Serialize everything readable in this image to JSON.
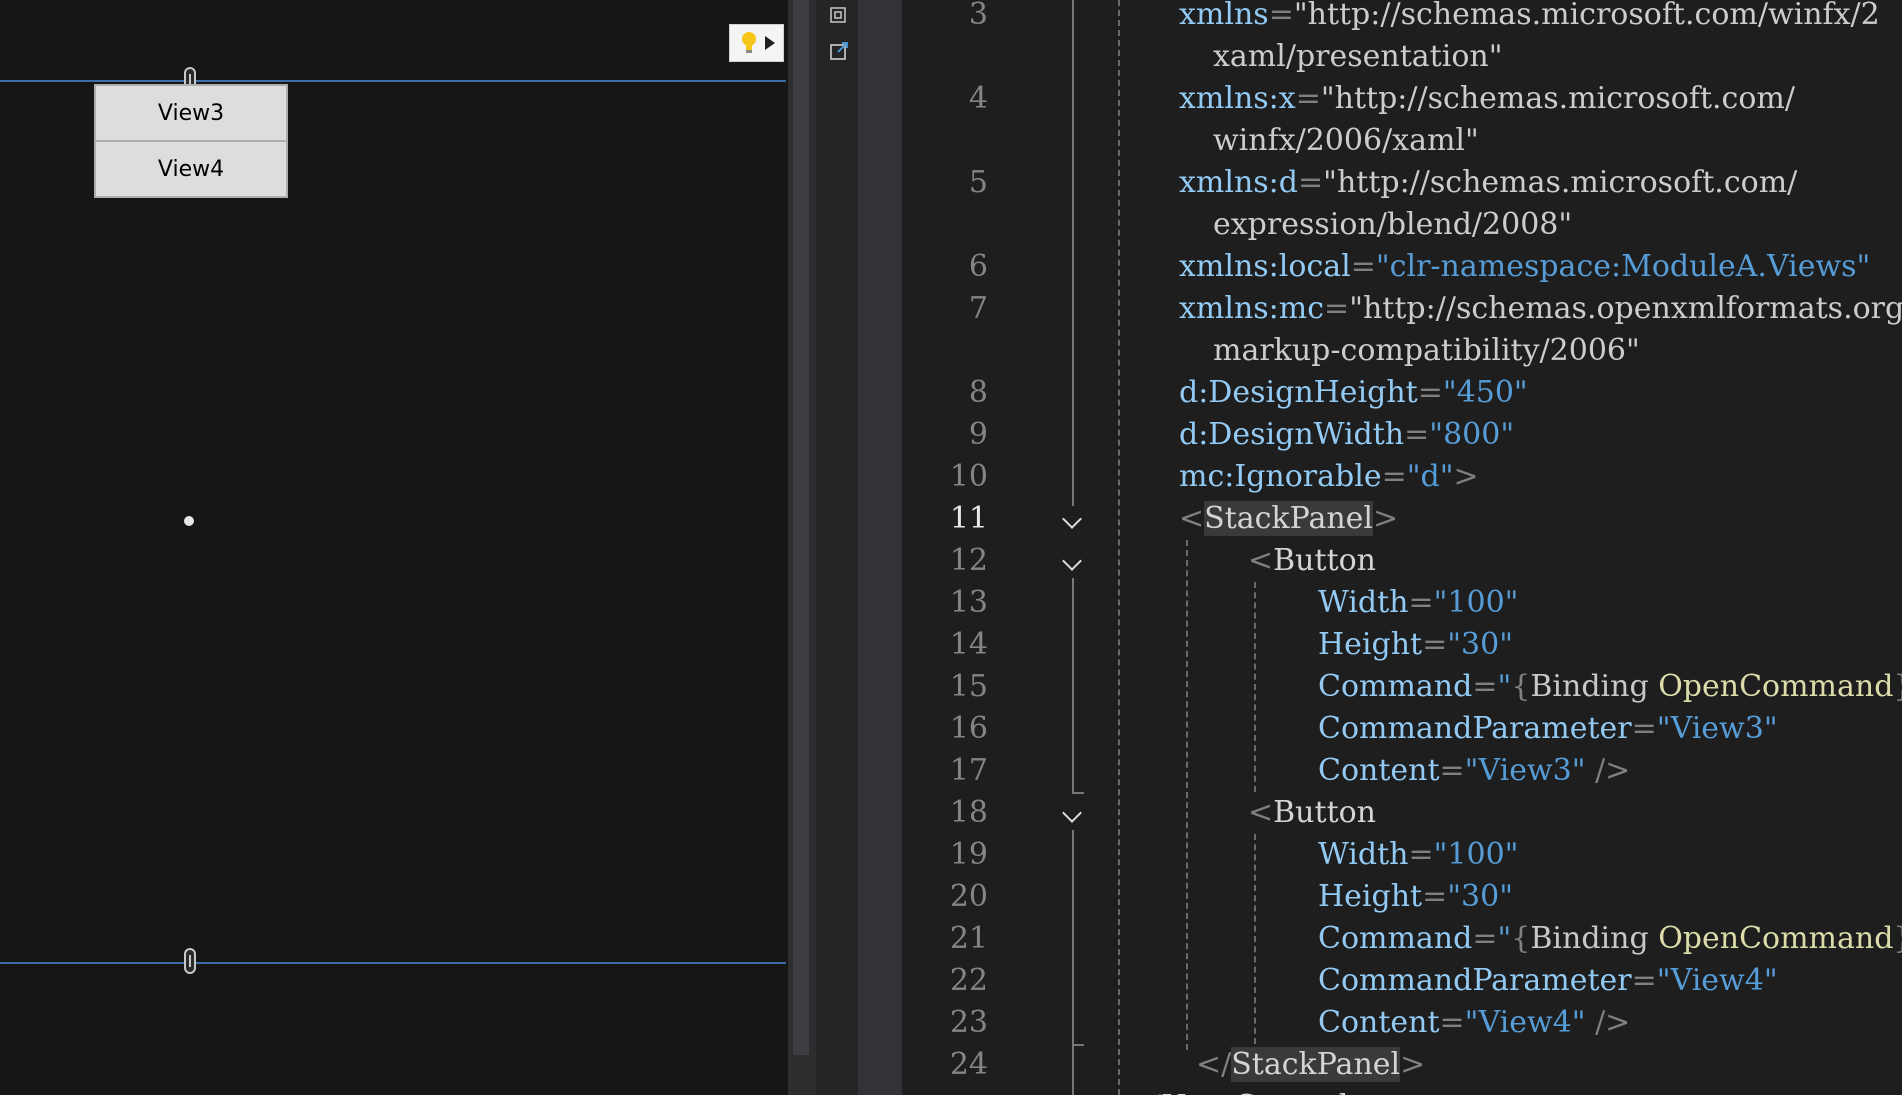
{
  "designer": {
    "buttons": [
      {
        "label": "View3"
      },
      {
        "label": "View4"
      }
    ],
    "lightbulb_icon": "lightbulb-icon"
  },
  "editor": {
    "lines": [
      {
        "n": "3",
        "text": "xmlns=\"http://schemas.microsoft.com/winfx/2"
      },
      {
        "n": "",
        "text": "xaml/presentation\""
      },
      {
        "n": "4",
        "text": "xmlns:x=\"http://schemas.microsoft.com/"
      },
      {
        "n": "",
        "text": "winfx/2006/xaml\""
      },
      {
        "n": "5",
        "text": "xmlns:d=\"http://schemas.microsoft.com/"
      },
      {
        "n": "",
        "text": "expression/blend/2008\""
      },
      {
        "n": "6",
        "text": "xmlns:local=\"clr-namespace:ModuleA.Views\""
      },
      {
        "n": "7",
        "text": "xmlns:mc=\"http://schemas.openxmlformats.org"
      },
      {
        "n": "",
        "text": "markup-compatibility/2006\""
      },
      {
        "n": "8",
        "text": "d:DesignHeight=\"450\""
      },
      {
        "n": "9",
        "text": "d:DesignWidth=\"800\""
      },
      {
        "n": "10",
        "text": "mc:Ignorable=\"d\">"
      },
      {
        "n": "11",
        "text": "<StackPanel>"
      },
      {
        "n": "12",
        "text": "<Button"
      },
      {
        "n": "13",
        "text": "Width=\"100\""
      },
      {
        "n": "14",
        "text": "Height=\"30\""
      },
      {
        "n": "15",
        "text": "Command=\"{Binding OpenCommand}\""
      },
      {
        "n": "16",
        "text": "CommandParameter=\"View3\""
      },
      {
        "n": "17",
        "text": "Content=\"View3\" />"
      },
      {
        "n": "18",
        "text": "<Button"
      },
      {
        "n": "19",
        "text": "Width=\"100\""
      },
      {
        "n": "20",
        "text": "Height=\"30\""
      },
      {
        "n": "21",
        "text": "Command=\"{Binding OpenCommand}\""
      },
      {
        "n": "22",
        "text": "CommandParameter=\"View4\""
      },
      {
        "n": "23",
        "text": "Content=\"View4\" />"
      },
      {
        "n": "24",
        "text": "</StackPanel>"
      },
      {
        "n": "",
        "text": "</UserControl>"
      }
    ],
    "active_line": "11",
    "colors": {
      "attribute": "#92caf4",
      "value": "#569cd6",
      "punctuation": "#808080",
      "binding_keyword": "#dcdcaa"
    }
  }
}
